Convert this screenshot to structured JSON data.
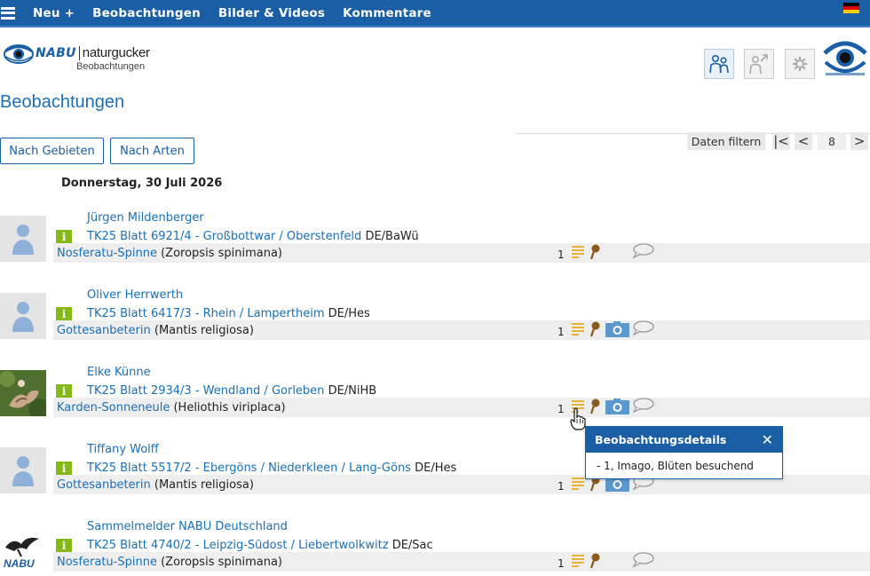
{
  "nav": {
    "items": [
      "Neu +",
      "Beobachtungen",
      "Bilder & Videos",
      "Kommentare"
    ],
    "language_flag": "flag-germany-icon"
  },
  "logo": {
    "brand": "NABU",
    "product": "naturgucker",
    "subtitle": "Beobachtungen"
  },
  "header": {
    "buttons": [
      "people-icon",
      "person-arrow-icon",
      "gear-icon"
    ],
    "emblem": "nabu-eye-emblem-icon"
  },
  "page_title": "Beobachtungen",
  "tabs": [
    "Nach Gebieten",
    "Nach Arten"
  ],
  "pager": {
    "filter_label": "Daten filtern",
    "first_label": "|<",
    "prev_label": "<",
    "page": "8",
    "next_label": ">"
  },
  "date_heading": "Donnerstag, 30 Juli 2026",
  "entries": [
    {
      "observer": "Jürgen Mildenberger",
      "location_link": "TK25 Blatt 6921/4 - Großbottwar / Oberstenfeld",
      "region": "DE/BaWü",
      "species_common": "Nosferatu-Spinne",
      "species_sci": "(Zoropsis spinimana)",
      "count": "1",
      "avatar": "placeholder-person-icon",
      "has_photo": false
    },
    {
      "observer": "Oliver Herrwerth",
      "location_link": "TK25 Blatt 6417/3 - Rhein / Lampertheim",
      "region": "DE/Hes",
      "species_common": "Gottesanbeterin",
      "species_sci": "(Mantis religiosa)",
      "count": "1",
      "avatar": "placeholder-person-icon",
      "has_photo": true
    },
    {
      "observer": "Elke Künne",
      "location_link": "TK25 Blatt 2934/3 - Wendland / Gorleben",
      "region": "DE/NiHB",
      "species_common": "Karden-Sonneneule",
      "species_sci": "(Heliothis viriplaca)",
      "count": "1",
      "avatar": "moth-photo-thumbnail",
      "has_photo": true
    },
    {
      "observer": "Tiffany Wolff",
      "location_link": "TK25 Blatt 5517/2 - Ebergöns / Niederkleen / Lang-Göns",
      "region": "DE/Hes",
      "species_common": "Gottesanbeterin",
      "species_sci": "(Mantis religiosa)",
      "count": "1",
      "avatar": "placeholder-person-icon",
      "has_photo": true
    },
    {
      "observer": "Sammelmelder NABU Deutschland",
      "location_link": "TK25 Blatt 4740/2 - Leipzig-Südost / Liebertwolkwitz",
      "region": "DE/Sac",
      "species_common": "Nosferatu-Spinne",
      "species_sci": "(Zoropsis spinimana)",
      "count": "1",
      "avatar": "nabu-logo-avatar",
      "avatar_text": "NABU",
      "has_photo": false
    }
  ],
  "popup": {
    "title": "Beobachtungsdetails",
    "close": "✕",
    "body": "- 1, Imago, Blüten besuchend"
  },
  "colors": {
    "nav_bg": "#1a5fa6",
    "link": "#1a6fb5",
    "info_green": "#85b919",
    "row_bg": "#eeeeee",
    "detail_yellow": "#e9b233",
    "camera_blue": "#5d98cc"
  }
}
